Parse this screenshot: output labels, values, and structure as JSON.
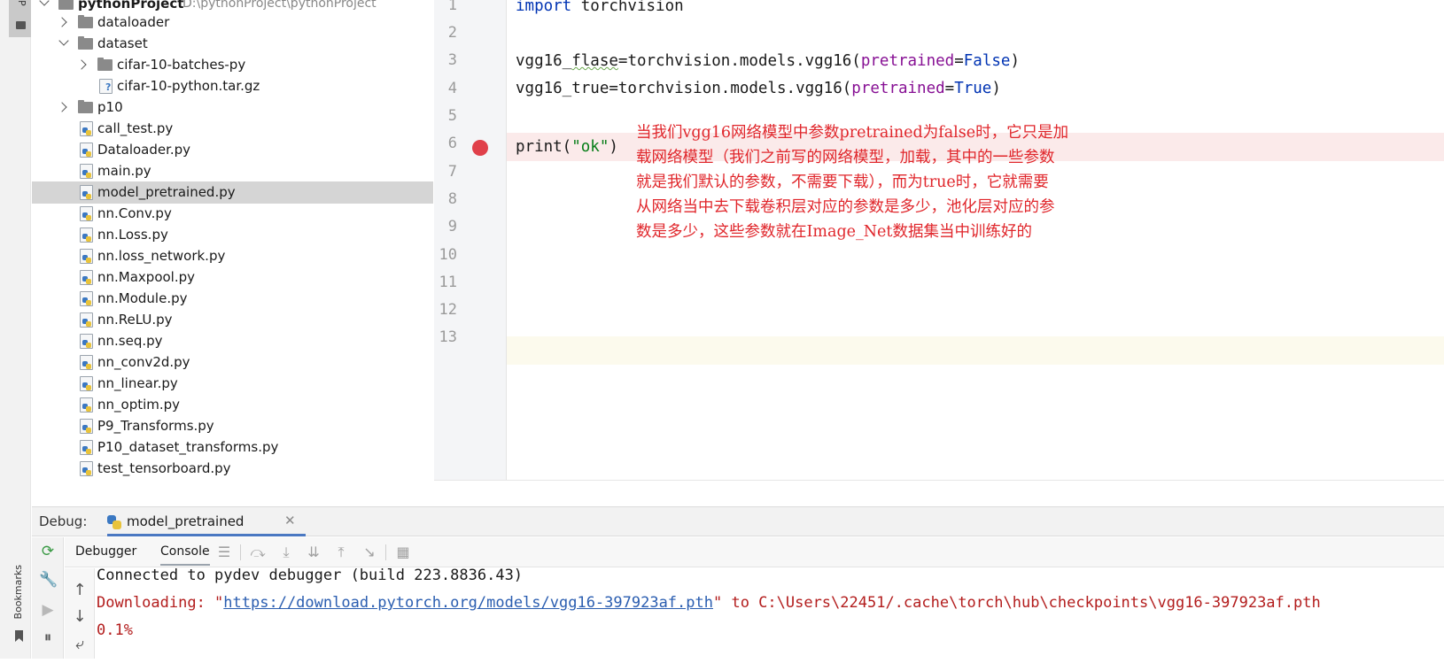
{
  "left_strip": {
    "project_tab": "P",
    "bookmarks_tab": "Bookmarks"
  },
  "project_tree": {
    "root": {
      "name": "pythonProject",
      "path": "D:\\pythonProject\\pythonProject"
    },
    "items": [
      {
        "label": "dataloader",
        "kind": "folder",
        "expanded": false
      },
      {
        "label": "dataset",
        "kind": "folder",
        "expanded": true
      },
      {
        "label": "cifar-10-batches-py",
        "kind": "folder",
        "expanded": false
      },
      {
        "label": "cifar-10-python.tar.gz",
        "kind": "file"
      },
      {
        "label": "p10",
        "kind": "folder",
        "expanded": false
      },
      {
        "label": "call_test.py",
        "kind": "py"
      },
      {
        "label": "Dataloader.py",
        "kind": "py"
      },
      {
        "label": "main.py",
        "kind": "py"
      },
      {
        "label": "model_pretrained.py",
        "kind": "py",
        "selected": true
      },
      {
        "label": "nn.Conv.py",
        "kind": "py"
      },
      {
        "label": "nn.Loss.py",
        "kind": "py"
      },
      {
        "label": "nn.loss_network.py",
        "kind": "py"
      },
      {
        "label": "nn.Maxpool.py",
        "kind": "py"
      },
      {
        "label": "nn.Module.py",
        "kind": "py"
      },
      {
        "label": "nn.ReLU.py",
        "kind": "py"
      },
      {
        "label": "nn.seq.py",
        "kind": "py"
      },
      {
        "label": "nn_conv2d.py",
        "kind": "py"
      },
      {
        "label": "nn_linear.py",
        "kind": "py"
      },
      {
        "label": "nn_optim.py",
        "kind": "py"
      },
      {
        "label": "P9_Transforms.py",
        "kind": "py"
      },
      {
        "label": "P10_dataset_transforms.py",
        "kind": "py"
      },
      {
        "label": "test_tensorboard.py",
        "kind": "py"
      }
    ]
  },
  "editor": {
    "line_numbers": [
      "1",
      "2",
      "3",
      "4",
      "5",
      "6",
      "7",
      "8",
      "9",
      "10",
      "11",
      "12",
      "13"
    ],
    "code": {
      "l1_kw": "import",
      "l1_rest": " torchvision",
      "l3_a": "vgg16_",
      "l3_b": "flase",
      "l3_c": "=torchvision.models.vgg16(",
      "l3_param": "pretrained",
      "l3_eq": "=",
      "l3_val": "False",
      "l3_end": ")",
      "l4_a": "vgg16_true=torchvision.models.vgg16(",
      "l4_param": "pretrained",
      "l4_eq": "=",
      "l4_val": "True",
      "l4_end": ")",
      "l6_a": "print(",
      "l6_str": "\"ok\"",
      "l6_end": ")"
    },
    "annotation": [
      "当我们vgg16网络模型中参数pretrained为false时，它只是加",
      "载网络模型（我们之前写的网络模型，加载，其中的一些参数",
      "就是我们默认的参数，不需要下载），而为true时，它就需要",
      "从网络当中去下载卷积层对应的参数是多少，池化层对应的参",
      "数是多少，这些参数就在Image_Net数据集当中训练好的"
    ],
    "breakpoint_line": 6
  },
  "debug": {
    "label": "Debug:",
    "tab_title": "model_pretrained",
    "tabs": {
      "debugger": "Debugger",
      "console": "Console"
    },
    "console": {
      "line1": "Connected to pydev debugger (build 223.8836.43)",
      "line2_prefix": "Downloading: \"",
      "line2_link": "https://download.pytorch.org/models/vgg16-397923af.pth",
      "line2_suffix": "\" to C:\\Users\\22451/.cache\\torch\\hub\\checkpoints\\vgg16-397923af.pth",
      "line3": "0.1%"
    }
  },
  "colors": {
    "breakpoint": "#e0404a",
    "annotation": "#e0262b",
    "keyword": "#0033b3",
    "param": "#871094",
    "string": "#067d17",
    "error_text": "#b31d1d",
    "link": "#2a5db0"
  }
}
